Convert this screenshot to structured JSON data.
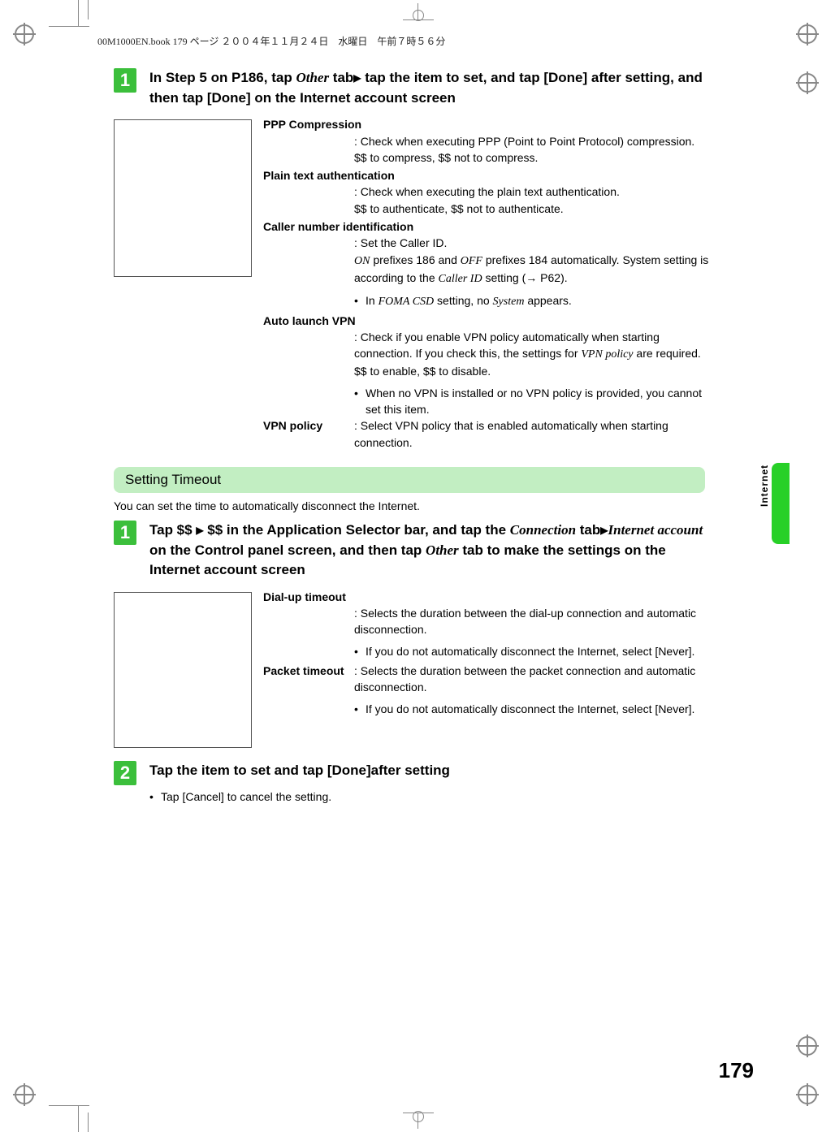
{
  "book_header": "00M1000EN.book  179 ページ  ２００４年１１月２４日　水曜日　午前７時５６分",
  "side_tab": "Internet",
  "page_number": "179",
  "section1": {
    "step_num": "1",
    "step_text_before": "In Step 5 on P186, tap ",
    "step_text_other": "Other",
    "step_text_mid": " tab",
    "step_text_tri": "▶",
    "step_text_after": " tap the item to set, and tap [Done] after setting, and then tap [Done] on the Internet account screen",
    "ppp": {
      "label": "PPP Compression",
      "body1": "Check when executing PPP (Point to Point Protocol) compression.",
      "body2": "$$ to compress, $$ not to compress."
    },
    "plain": {
      "label": "Plain text authentication",
      "body1": "Check when executing the plain text authentication.",
      "body2": "$$ to authenticate, $$ not to authenticate."
    },
    "caller": {
      "label": "Caller number identification",
      "body1": "Set the Caller ID.",
      "body2_on": "ON",
      "body2_mid": " prefixes 186 and ",
      "body2_off": "OFF",
      "body2_after": " prefixes 184 automatically. System setting is according to the ",
      "body2_callerid": "Caller ID",
      "body2_setting": " setting (",
      "body2_ref": " P62).",
      "bullet_in": "In ",
      "bullet_foma": "FOMA CSD",
      "bullet_mid": " setting, no ",
      "bullet_system": "System",
      "bullet_after": " appears."
    },
    "autovpn": {
      "label": "Auto launch VPN",
      "body1a": "Check if you enable VPN policy automatically when starting connection. If you check this, the settings for ",
      "body1_vpnp": "VPN policy",
      "body1b": " are required.",
      "body2": "$$ to enable, $$ to disable.",
      "bullet": "When no VPN is installed or no VPN policy is provided, you cannot set this item."
    },
    "vpnpolicy": {
      "label": "VPN policy",
      "body": "Select VPN policy that is enabled automatically when starting connection."
    }
  },
  "section2": {
    "title": "Setting Timeout",
    "intro": "You can set the time to automatically disconnect the Internet.",
    "step1": {
      "num": "1",
      "t1": "Tap $$ ",
      "tri1": "▶",
      "t2": " $$ in the Application Selector bar, and tap the ",
      "conn": "Connection",
      "t3": " tab",
      "tri2": "▶",
      "ia": "Internet account",
      "t4": " on the Control panel screen, and then tap ",
      "other": "Other",
      "t5": " tab to make the settings on the Internet account screen"
    },
    "dialup": {
      "label": "Dial-up timeout",
      "body": "Selects the duration between the dial-up connection and automatic disconnection.",
      "bullet": "If you do not automatically disconnect the Internet, select [Never]."
    },
    "packet": {
      "label": "Packet timeout",
      "body": "Selects the duration between the packet connection and automatic disconnection.",
      "bullet": "If you do not automatically disconnect the Internet, select [Never]."
    },
    "step2": {
      "num": "2",
      "text": "Tap the item to set and tap [Done]after setting",
      "bullet": "Tap [Cancel] to cancel the setting."
    }
  }
}
